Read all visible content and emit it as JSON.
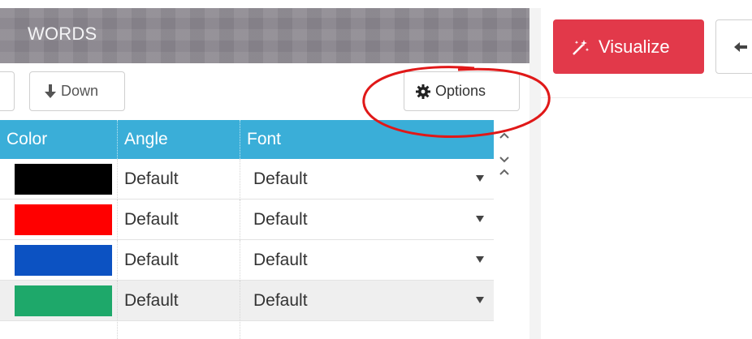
{
  "panel": {
    "title": "WORDS"
  },
  "toolbar": {
    "down_label": "Down",
    "options_label": "Options"
  },
  "table": {
    "headers": [
      "Color",
      "Angle",
      "Font"
    ],
    "rows": [
      {
        "color": "#000000",
        "angle": "Default",
        "font": "Default"
      },
      {
        "color": "#ff0000",
        "angle": "Default",
        "font": "Default"
      },
      {
        "color": "#0c52c2",
        "angle": "Default",
        "font": "Default"
      },
      {
        "color": "#1ea86a",
        "angle": "Default",
        "font": "Default"
      }
    ]
  },
  "actions": {
    "visualize_label": "Visualize"
  },
  "colors": {
    "header_bg": "#3aaed8",
    "visualize_bg": "#e2394a",
    "annotation": "#e01818"
  }
}
